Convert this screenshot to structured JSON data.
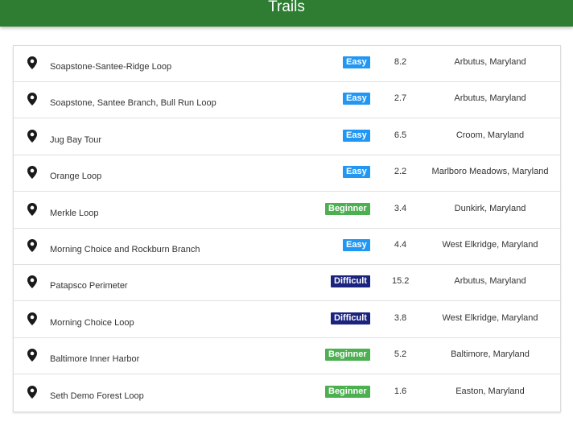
{
  "header": {
    "title": "Trails"
  },
  "colors": {
    "header": "#2e7d32",
    "easy": "#2196f3",
    "beginner": "#4caf50",
    "difficult": "#1a237e"
  },
  "trails": [
    {
      "icon": "map-pin-icon",
      "name": "Soapstone-Santee-Ridge Loop",
      "difficulty": "Easy",
      "distance": "8.2",
      "location": "Arbutus, Maryland"
    },
    {
      "icon": "map-pin-icon",
      "name": "Soapstone, Santee Branch, Bull Run Loop",
      "difficulty": "Easy",
      "distance": "2.7",
      "location": "Arbutus, Maryland"
    },
    {
      "icon": "map-pin-icon",
      "name": "Jug Bay Tour",
      "difficulty": "Easy",
      "distance": "6.5",
      "location": "Croom, Maryland"
    },
    {
      "icon": "map-pin-icon",
      "name": "Orange Loop",
      "difficulty": "Easy",
      "distance": "2.2",
      "location": "Marlboro Meadows, Maryland"
    },
    {
      "icon": "map-pin-icon",
      "name": "Merkle Loop",
      "difficulty": "Beginner",
      "distance": "3.4",
      "location": "Dunkirk, Maryland"
    },
    {
      "icon": "map-pin-icon",
      "name": "Morning Choice and Rockburn Branch",
      "difficulty": "Easy",
      "distance": "4.4",
      "location": "West Elkridge, Maryland"
    },
    {
      "icon": "map-pin-icon",
      "name": "Patapsco Perimeter",
      "difficulty": "Difficult",
      "distance": "15.2",
      "location": "Arbutus, Maryland"
    },
    {
      "icon": "map-pin-icon",
      "name": "Morning Choice Loop",
      "difficulty": "Difficult",
      "distance": "3.8",
      "location": "West Elkridge, Maryland"
    },
    {
      "icon": "map-pin-icon",
      "name": "Baltimore Inner Harbor",
      "difficulty": "Beginner",
      "distance": "5.2",
      "location": "Baltimore, Maryland"
    },
    {
      "icon": "map-pin-icon",
      "name": "Seth Demo Forest Loop",
      "difficulty": "Beginner",
      "distance": "1.6",
      "location": "Easton, Maryland"
    }
  ]
}
